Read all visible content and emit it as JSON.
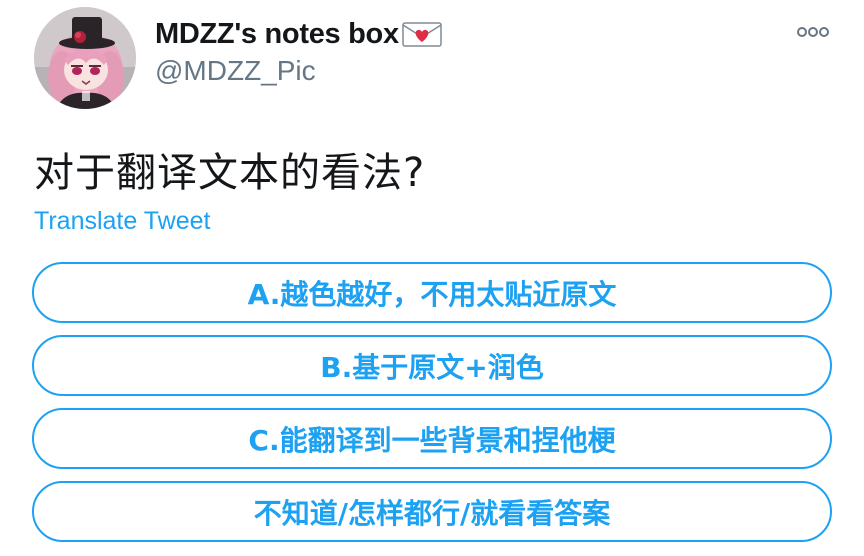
{
  "tweet": {
    "author": {
      "display_name": "MDZZ's notes box",
      "name_emoji_icon": "love-letter-icon",
      "handle": "@MDZZ_Pic",
      "avatar_icon": "avatar-image"
    },
    "more_icon": "more-options-icon",
    "text": "对于翻译文本的看法?",
    "translate_label": "Translate Tweet",
    "poll": {
      "options": [
        {
          "label": "A.越色越好，不用太贴近原文"
        },
        {
          "label": "B.基于原文+润色"
        },
        {
          "label": "C.能翻译到一些背景和捏他梗"
        },
        {
          "label": "不知道/怎样都行/就看看答案"
        }
      ]
    }
  },
  "colors": {
    "accent": "#1da1f2",
    "text_primary": "#14171a",
    "text_secondary": "#657786"
  }
}
